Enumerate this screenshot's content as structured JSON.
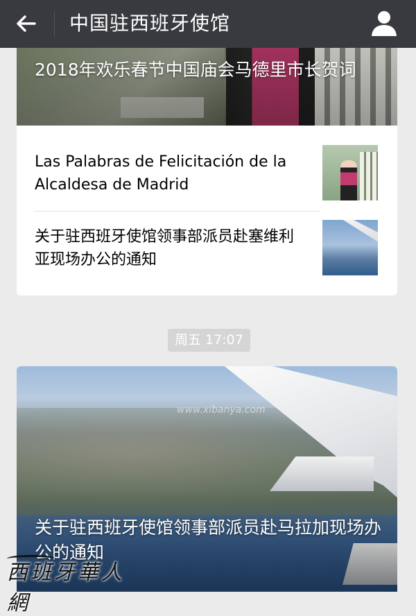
{
  "header": {
    "title": "中国驻西班牙使馆",
    "back_icon": "arrow-left-icon",
    "profile_icon": "user-icon"
  },
  "card1": {
    "hero_title": "2018年欢乐春节中国庙会马德里市长贺词",
    "items": [
      {
        "title": "Las Palabras de Felicitación de la Alcaldesa de Madrid",
        "thumb": "madrid-mayor-photo"
      },
      {
        "title": "关于驻西班牙使馆领事部派员赴塞维利亚现场办公的通知",
        "thumb": "airplane-wing-photo"
      }
    ]
  },
  "timestamp": "周五 17:07",
  "card2": {
    "hero_title": "关于驻西班牙使馆领事部派员赴马拉加现场办公的通知"
  },
  "watermarks": {
    "center": "www.xibanya.com",
    "logo": "西班牙華人網"
  },
  "colors": {
    "topbar": "#393a3f",
    "background": "#ebebeb",
    "card": "#ffffff",
    "time_chip": "#d5d5d5"
  }
}
